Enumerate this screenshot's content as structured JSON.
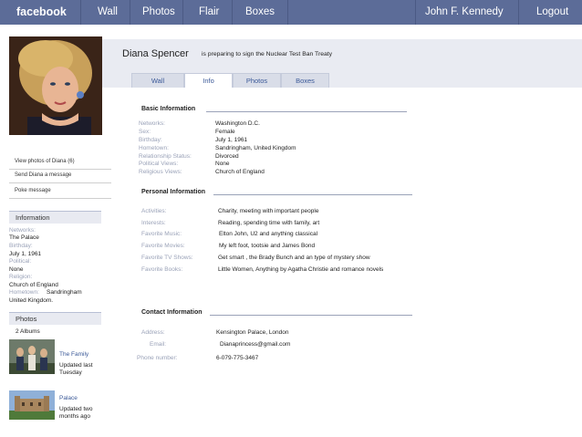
{
  "topnav": {
    "logo": "facebook",
    "wall": "Wall",
    "photos": "Photos",
    "flair": "Flair",
    "boxes": "Boxes",
    "user": "John F. Kennedy",
    "logout": "Logout"
  },
  "profile": {
    "name": "Diana Spencer",
    "status": "is preparing to sign the Nuclear Test Ban Treaty"
  },
  "tabs": [
    "Wall",
    "Info",
    "Photos",
    "Boxes"
  ],
  "sidebar": {
    "links": [
      "View photos of Diana (6)",
      "Send Diana a message",
      "Poke message"
    ],
    "info_heading": "Information",
    "info": {
      "networks_label": "Networks:",
      "networks_value": "The Palace",
      "birthday_label": "Birthday:",
      "birthday_value": "July 1, 1961",
      "political_label": "Political:",
      "political_value": "None",
      "religion_label": "Religion:",
      "religion_value": "Church of England",
      "hometown_label": "Hometown:",
      "hometown_value": "Sandringham",
      "hometown_value_cont": "United Kingdom."
    },
    "photos_heading": "Photos",
    "albums_count": "2 Albums",
    "albums": [
      {
        "name": "The Family",
        "meta1": "Updated last",
        "meta2": "Tuesday"
      },
      {
        "name": "Palace",
        "meta1": "Updated two",
        "meta2": "months ago"
      }
    ]
  },
  "basic": {
    "title": "Basic Information",
    "rows": [
      {
        "label": "Networks:",
        "value": "Washington D.C."
      },
      {
        "label": "Sex:",
        "value": "Female"
      },
      {
        "label": "Birthday:",
        "value": "July 1, 1961"
      },
      {
        "label": "Hometown:",
        "value": "Sandringham, United Kingdom"
      },
      {
        "label": "Relationship Status:",
        "value": "Divorced"
      },
      {
        "label": "Political Views:",
        "value": "None"
      },
      {
        "label": "Religious Views:",
        "value": "Church of England"
      }
    ]
  },
  "personal": {
    "title": "Personal Information",
    "rows": [
      {
        "label": "Activities:",
        "value": "Charity, meeting with important people"
      },
      {
        "label": "Interests:",
        "value": "Reading, spending time with family, art"
      },
      {
        "label": "Favorite Music:",
        "value": "Elton John, U2 and anything classical"
      },
      {
        "label": "Favorite Movies:",
        "value": "My left foot, tootsie and James Bond"
      },
      {
        "label": "Favorite TV Shows:",
        "value": "Get smart , the Brady Bunch and an type of mystery show"
      },
      {
        "label": "Favorite Books:",
        "value": "Little Women, Anything by Agatha Christie and romance novels"
      }
    ]
  },
  "contact": {
    "title": "Contact Information",
    "rows": [
      {
        "label": "Address:",
        "value": "Kensington Palace, London"
      },
      {
        "label": "Email:",
        "value": "Dianaprincess@gmail.com"
      },
      {
        "label": "Phone number:",
        "value": "6-079-775-3467"
      }
    ]
  },
  "colors": {
    "topbar": "#5c6c98",
    "link": "#3b5998",
    "label": "#9aa2b8",
    "band": "#e9ebf2"
  }
}
